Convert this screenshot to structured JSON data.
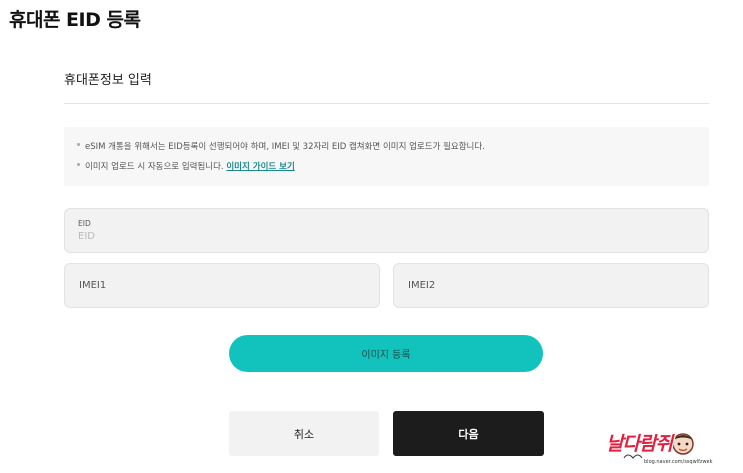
{
  "page_title": "휴대폰 EID 등록",
  "section": {
    "title": "휴대폰정보 입력"
  },
  "notice": {
    "line1": "eSIM 개통을 위해서는 EID등록이 선행되어야 하며, IMEI 및 32자리 EID 캡쳐화면 이미지 업로드가 필요합니다.",
    "line2_text": "이미지 업로드 시 자동으로 입력됩니다.",
    "line2_link": "이미지 가이드 보기"
  },
  "fields": {
    "eid": {
      "label": "EID",
      "placeholder": "EID",
      "value": ""
    },
    "imei1": {
      "placeholder": "IMEI1",
      "value": ""
    },
    "imei2": {
      "placeholder": "IMEI2",
      "value": ""
    }
  },
  "buttons": {
    "upload_image": "이미지 등록",
    "cancel": "취소",
    "next": "다음"
  },
  "watermark": {
    "text": "날다람쥐",
    "url": "blog.naver.com/ssqwlfzwek"
  },
  "colors": {
    "accent": "#12c3bd",
    "primary_button": "#1c1c1c",
    "secondary_button": "#f2f2f2",
    "link": "#1a8a8a",
    "watermark": "#e0213f"
  }
}
